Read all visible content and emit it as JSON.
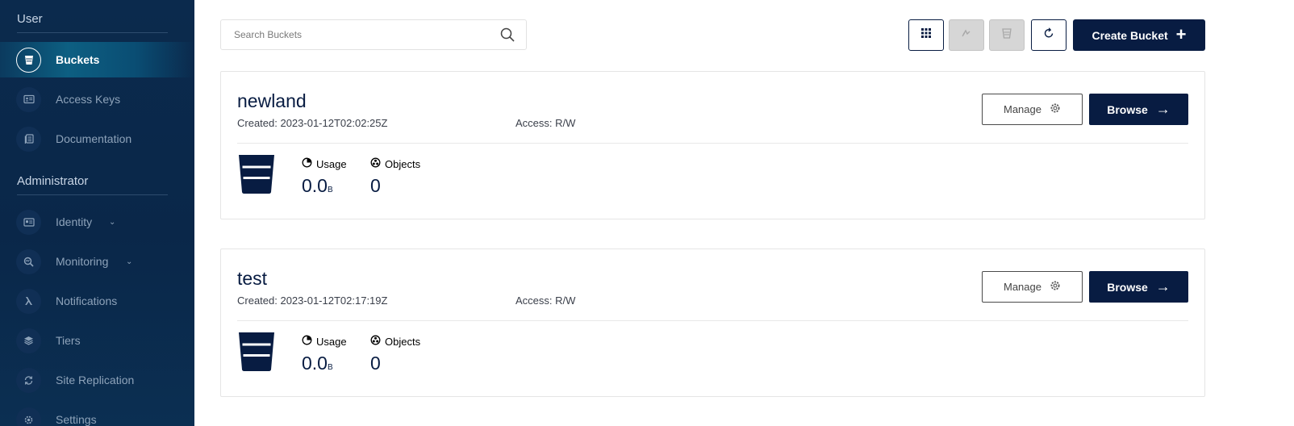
{
  "sidebar": {
    "sections": [
      {
        "title": "User"
      },
      {
        "title": "Administrator"
      }
    ],
    "items": [
      {
        "label": "Buckets",
        "icon": "bucket-icon",
        "active": true
      },
      {
        "label": "Access Keys",
        "icon": "access-keys-icon"
      },
      {
        "label": "Documentation",
        "icon": "documentation-icon"
      },
      {
        "label": "Identity",
        "icon": "identity-icon",
        "expandable": true
      },
      {
        "label": "Monitoring",
        "icon": "monitoring-icon",
        "expandable": true
      },
      {
        "label": "Notifications",
        "icon": "lambda-icon"
      },
      {
        "label": "Tiers",
        "icon": "tiers-icon"
      },
      {
        "label": "Site Replication",
        "icon": "site-replication-icon"
      },
      {
        "label": "Settings",
        "icon": "settings-icon"
      }
    ]
  },
  "toolbar": {
    "search_placeholder": "Search Buckets",
    "buttons": [
      {
        "icon": "grid-select-icon",
        "enabled": true
      },
      {
        "icon": "replication-icon",
        "enabled": false
      },
      {
        "icon": "bucket-lifecycle-icon",
        "enabled": false
      },
      {
        "icon": "refresh-icon",
        "enabled": true
      }
    ],
    "create_label": "Create Bucket",
    "create_icon": "+"
  },
  "buckets": [
    {
      "name": "newland",
      "created": "Created: 2023-01-12T02:02:25Z",
      "access": "Access: R/W",
      "manage_label": "Manage",
      "browse_label": "Browse",
      "browse_icon": "→",
      "usage_label": "Usage",
      "usage_value": "0.0",
      "usage_unit": "B",
      "objects_label": "Objects",
      "objects_value": "0"
    },
    {
      "name": "test",
      "created": "Created: 2023-01-12T02:17:19Z",
      "access": "Access: R/W",
      "manage_label": "Manage",
      "browse_label": "Browse",
      "browse_icon": "→",
      "usage_label": "Usage",
      "usage_value": "0.0",
      "usage_unit": "B",
      "objects_label": "Objects",
      "objects_value": "0"
    }
  ],
  "colors": {
    "sidebar": "#0b2a4d",
    "primary": "#081c42",
    "disabled": "#d6d6d6"
  }
}
